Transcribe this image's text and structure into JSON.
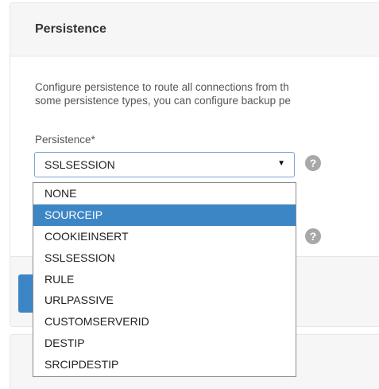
{
  "panel": {
    "title": "Persistence",
    "description_line1": "Configure persistence to route all connections from th",
    "description_line2": "some persistence types, you can configure backup pe",
    "persistence_label": "Persistence*",
    "persistence_value": "SSLSESSION",
    "help_icon_glyph": "?"
  },
  "dropdown": {
    "highlighted_index": 1,
    "options": [
      "NONE",
      "SOURCEIP",
      "COOKIEINSERT",
      "SSLSESSION",
      "RULE",
      "URLPASSIVE",
      "CUSTOMSERVERID",
      "DESTIP",
      "SRCIPDESTIP"
    ]
  },
  "colors": {
    "accent": "#3d86c6",
    "panel_bg": "#f6f6f6",
    "help_icon": "#a8a8a8"
  },
  "icons": {
    "select_arrow": "triangle-down-icon",
    "help": "question-circle-icon"
  }
}
